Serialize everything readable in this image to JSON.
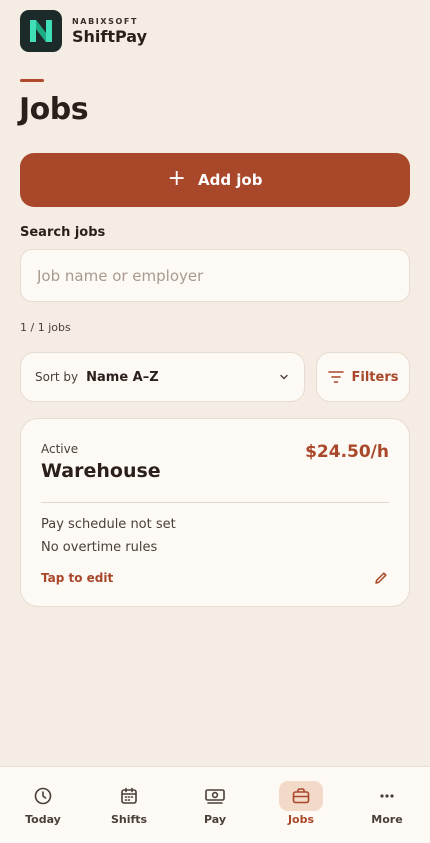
{
  "brand": {
    "company": "NABIXSOFT",
    "app_name": "ShiftPay",
    "logo_icon": "n-logo-icon"
  },
  "page": {
    "title": "Jobs"
  },
  "actions": {
    "add_job_label": "Add job",
    "add_icon": "plus-icon"
  },
  "search": {
    "label": "Search jobs",
    "placeholder": "Job name or employer",
    "value": ""
  },
  "results": {
    "count_text": "1 / 1 jobs"
  },
  "sort": {
    "prefix": "Sort by",
    "value": "Name A–Z",
    "icon": "chevron-down-icon"
  },
  "filters": {
    "label": "Filters",
    "icon": "filter-icon"
  },
  "jobs": [
    {
      "status": "Active",
      "name": "Warehouse",
      "rate": "$24.50/h",
      "pay_schedule": "Pay schedule not set",
      "overtime": "No overtime rules",
      "edit_label": "Tap to edit",
      "edit_icon": "pencil-icon"
    }
  ],
  "nav": {
    "items": [
      {
        "label": "Today",
        "icon": "clock-icon",
        "active": false
      },
      {
        "label": "Shifts",
        "icon": "calendar-icon",
        "active": false
      },
      {
        "label": "Pay",
        "icon": "money-icon",
        "active": false
      },
      {
        "label": "Jobs",
        "icon": "briefcase-icon",
        "active": true
      },
      {
        "label": "More",
        "icon": "more-icon",
        "active": false
      }
    ]
  },
  "colors": {
    "accent": "#a9472a",
    "background": "#f5ece3",
    "card": "#fdf9f4",
    "text": "#2a1f1a"
  }
}
